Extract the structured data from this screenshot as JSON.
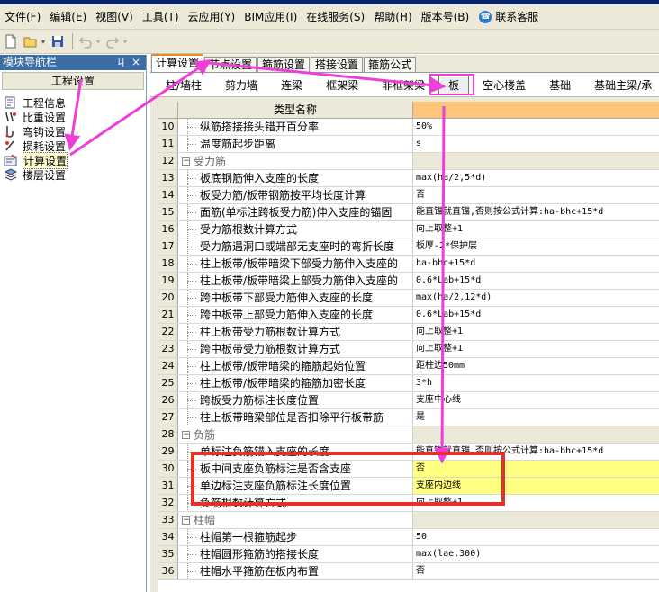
{
  "menu": [
    "文件(F)",
    "编辑(E)",
    "视图(V)",
    "工具(T)",
    "云应用(Y)",
    "BIM应用(I)",
    "在线服务(S)",
    "帮助(H)",
    "版本号(B)",
    "联系客服"
  ],
  "left_panel": {
    "title": "模块导航栏",
    "pin": "ㄐ",
    "close": "×",
    "group": "工程设置",
    "items": [
      {
        "label": "工程信息",
        "icon": "info-sheet-icon"
      },
      {
        "label": "比重设置",
        "icon": "weight-icon"
      },
      {
        "label": "弯钩设置",
        "icon": "hook-icon"
      },
      {
        "label": "损耗设置",
        "icon": "loss-icon"
      },
      {
        "label": "计算设置",
        "icon": "calc-icon"
      },
      {
        "label": "楼层设置",
        "icon": "floors-icon"
      }
    ],
    "selected_index": 4
  },
  "tabs": [
    "计算设置",
    "节点设置",
    "箍筋设置",
    "搭接设置",
    "箍筋公式"
  ],
  "subtabs": [
    "柱/墙柱",
    "剪力墙",
    "连梁",
    "框架梁",
    "非框架梁",
    "板",
    "空心楼盖",
    "基础",
    "基础主梁/承"
  ],
  "active_subtab": 5,
  "grid": {
    "header": "类型名称",
    "rows": [
      {
        "no": "10",
        "name": "纵筋搭接接头错开百分率",
        "value": "50%"
      },
      {
        "no": "11",
        "name": "温度筋起步距离",
        "value": "s"
      },
      {
        "no": "12",
        "name": "受力筋",
        "value": "",
        "group": true
      },
      {
        "no": "13",
        "name": "板底钢筋伸入支座的长度",
        "value": "max(ha/2,5*d)"
      },
      {
        "no": "14",
        "name": "板受力筋/板带钢筋按平均长度计算",
        "value": "否"
      },
      {
        "no": "15",
        "name": "面筋(单标注跨板受力筋)伸入支座的锚固",
        "value": "能直锚就直锚,否则按公式计算:ha-bhc+15*d"
      },
      {
        "no": "16",
        "name": "受力筋根数计算方式",
        "value": "向上取整+1"
      },
      {
        "no": "17",
        "name": "受力筋遇洞口或端部无支座时的弯折长度",
        "value": "板厚-2*保护层"
      },
      {
        "no": "18",
        "name": "柱上板带/板带暗梁下部受力筋伸入支座的",
        "value": "ha-bhc+15*d"
      },
      {
        "no": "19",
        "name": "柱上板带/板带暗梁上部受力筋伸入支座的",
        "value": "0.6*Lab+15*d"
      },
      {
        "no": "20",
        "name": "跨中板带下部受力筋伸入支座的长度",
        "value": "max(ha/2,12*d)"
      },
      {
        "no": "21",
        "name": "跨中板带上部受力筋伸入支座的长度",
        "value": "0.6*Lab+15*d"
      },
      {
        "no": "22",
        "name": "柱上板带受力筋根数计算方式",
        "value": "向上取整+1"
      },
      {
        "no": "23",
        "name": "跨中板带受力筋根数计算方式",
        "value": "向上取整+1"
      },
      {
        "no": "24",
        "name": "柱上板带/板带暗梁的箍筋起始位置",
        "value": "距柱边50mm"
      },
      {
        "no": "25",
        "name": "柱上板带/板带暗梁的箍筋加密长度",
        "value": "3*h"
      },
      {
        "no": "26",
        "name": "跨板受力筋标注长度位置",
        "value": "支座中心线"
      },
      {
        "no": "27",
        "name": "柱上板带暗梁部位是否扣除平行板带筋",
        "value": "是"
      },
      {
        "no": "28",
        "name": "负筋",
        "value": "",
        "group": true
      },
      {
        "no": "29",
        "name": "单标注负筋锚入支座的长度",
        "value": "能直锚就直锚,否则按公式计算:ha-bhc+15*d"
      },
      {
        "no": "30",
        "name": "板中间支座负筋标注是否含支座",
        "value": "否",
        "highlight": true
      },
      {
        "no": "31",
        "name": "单边标注支座负筋标注长度位置",
        "value": "支座内边线",
        "highlight": true
      },
      {
        "no": "32",
        "name": "负筋根数计算方式",
        "value": "向上取整+1"
      },
      {
        "no": "33",
        "name": "柱帽",
        "value": "",
        "group": true
      },
      {
        "no": "34",
        "name": "柱帽第一根箍筋起步",
        "value": "50"
      },
      {
        "no": "35",
        "name": "柱帽圆形箍筋的搭接长度",
        "value": "max(lae,300)"
      },
      {
        "no": "36",
        "name": "柱帽水平箍筋在板内布置",
        "value": "否"
      }
    ]
  },
  "colors": {
    "annotation": "#ee3fd8",
    "highlight_box": "#e8302a",
    "highlight_cell": "#ffff80",
    "header_value": "#fcc57a"
  }
}
